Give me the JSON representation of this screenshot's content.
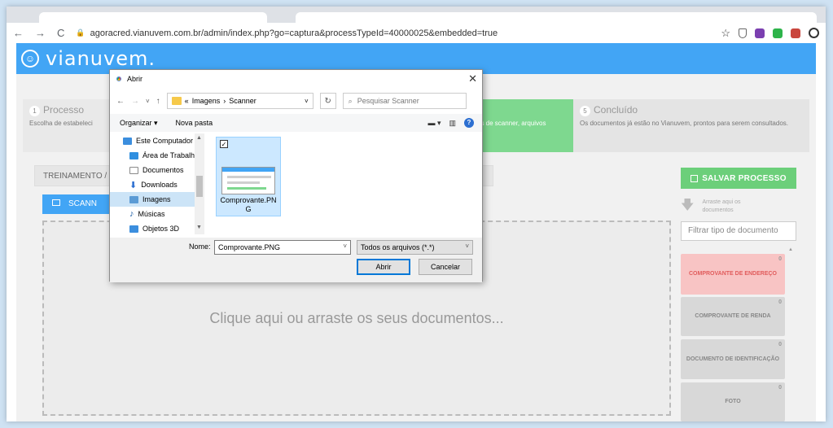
{
  "browser": {
    "url": "agoracred.vianuvem.com.br/admin/index.php?go=captura&processTypeId=40000025&embedded=true",
    "nav_back": "←",
    "nav_forward": "→",
    "nav_reload": "C",
    "star": "☆",
    "menu": "⋮"
  },
  "app": {
    "logo_text": "vianuvem."
  },
  "steps": [
    {
      "num": "1",
      "title": "Processo",
      "desc": "Escolha de estabelecim... processo."
    },
    {
      "num": "",
      "title": "",
      "desc": "ves de scanner, arquivos"
    },
    {
      "num": "5",
      "title": "Concluído",
      "desc": "Os documentos já estão no Vianuvem, prontos para serem consultados."
    }
  ],
  "breadcrumb": "TREINAMENTO /",
  "scan_button": "SCANN",
  "dropzone_text": "Clique aqui ou arraste os seus documentos...",
  "save_button": "SALVAR PROCESSO",
  "drag_hint": "Arraste aqui os documentos",
  "filter_placeholder": "Filtrar tipo de documento",
  "documents": [
    {
      "count": "0",
      "label": "COMPROVANTE DE ENDEREÇO"
    },
    {
      "count": "0",
      "label": "COMPROVANTE DE RENDA"
    },
    {
      "count": "0",
      "label": "DOCUMENTO DE IDENTIFICAÇÃO"
    },
    {
      "count": "0",
      "label": "FOTO"
    }
  ],
  "dialog": {
    "title": "Abrir",
    "path_prefix": "«",
    "path_1": "Imagens",
    "path_sep": "›",
    "path_2": "Scanner",
    "search_placeholder": "Pesquisar Scanner",
    "organize": "Organizar ▾",
    "new_folder": "Nova pasta",
    "tree": [
      {
        "label": "Este Computador",
        "icon_color": "#3b8ede"
      },
      {
        "label": "Área de Trabalho",
        "icon_color": "#2f8fe0"
      },
      {
        "label": "Documentos",
        "icon_color": "#8a8a8a"
      },
      {
        "label": "Downloads",
        "icon_color": "#2c6fd1"
      },
      {
        "label": "Imagens",
        "icon_color": "#5b9bd5"
      },
      {
        "label": "Músicas",
        "icon_color": "#1e5fa8"
      },
      {
        "label": "Objetos 3D",
        "icon_color": "#3b8ede"
      }
    ],
    "file_name": "Comprovante.PNG",
    "file_check": "✓",
    "name_label": "Nome:",
    "name_value": "Comprovante.PNG",
    "type_value": "Todos os arquivos (*.*)",
    "open_button": "Abrir",
    "cancel_button": "Cancelar",
    "close": "✕",
    "help": "?"
  }
}
